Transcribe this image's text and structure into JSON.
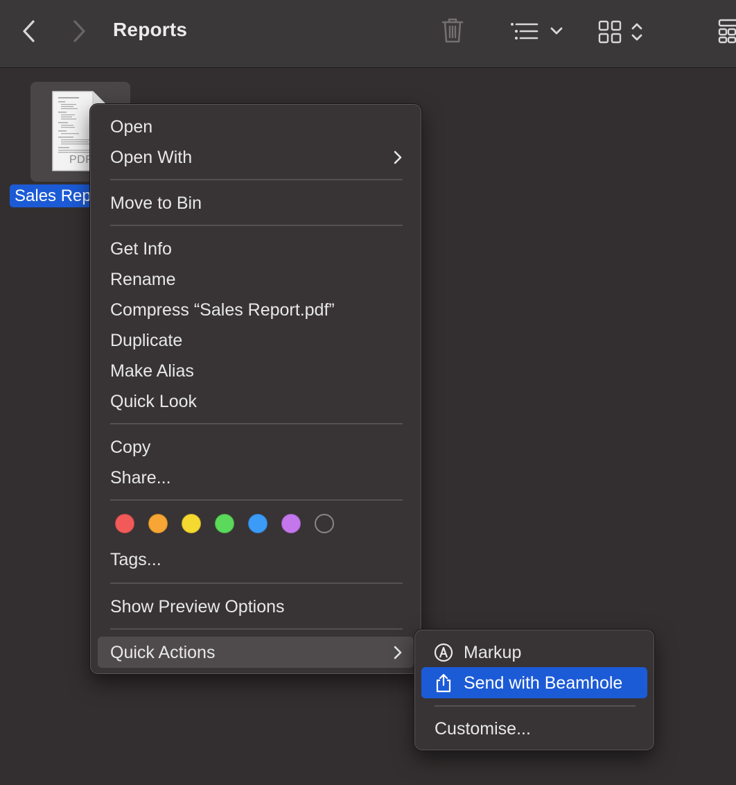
{
  "toolbar": {
    "title": "Reports",
    "back_icon": "chevron-left-icon",
    "forward_icon": "chevron-right-icon",
    "delete_icon": "trash-icon",
    "group_icon": "list-indent-icon",
    "view_icon": "grid-icon"
  },
  "file": {
    "name": "Sales Rep",
    "type_label": "PDF"
  },
  "context_menu": {
    "open": "Open",
    "open_with": "Open With",
    "move_to_bin": "Move to Bin",
    "get_info": "Get Info",
    "rename": "Rename",
    "compress": "Compress “Sales Report.pdf”",
    "duplicate": "Duplicate",
    "make_alias": "Make Alias",
    "quick_look": "Quick Look",
    "copy": "Copy",
    "share": "Share...",
    "tags": "Tags...",
    "show_preview_options": "Show Preview Options",
    "quick_actions": "Quick Actions"
  },
  "tag_colors": [
    {
      "name": "red",
      "color": "#f25a5a"
    },
    {
      "name": "orange",
      "color": "#f7a534"
    },
    {
      "name": "yellow",
      "color": "#f5d830"
    },
    {
      "name": "green",
      "color": "#5bd95a"
    },
    {
      "name": "blue",
      "color": "#3b9bf7"
    },
    {
      "name": "purple",
      "color": "#c476ec"
    }
  ],
  "quick_actions_menu": {
    "markup": "Markup",
    "send_with_beamhole": "Send with Beamhole",
    "customise": "Customise..."
  },
  "colors": {
    "accent": "#1c5bd6",
    "background": "#332f30",
    "menu_background": "#383435"
  }
}
